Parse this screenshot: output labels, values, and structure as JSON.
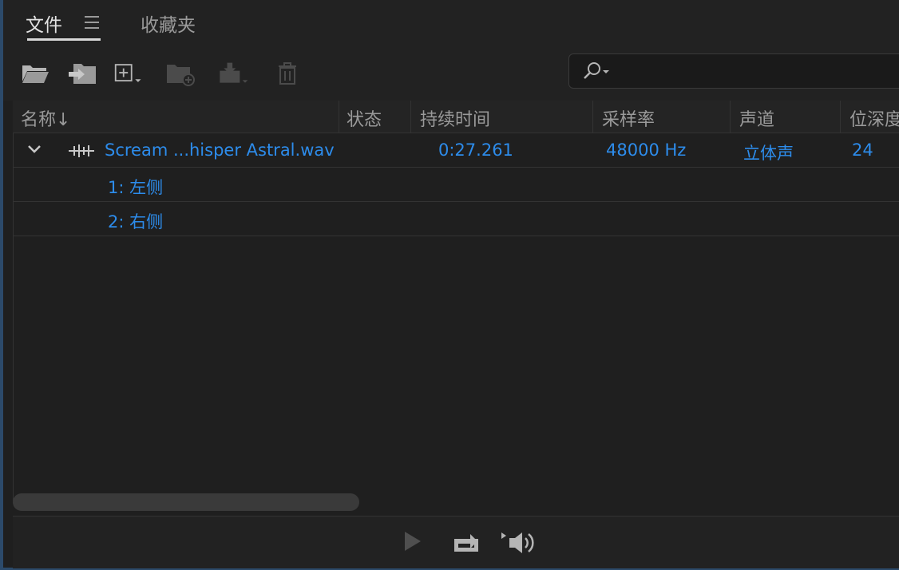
{
  "tabs": {
    "files_label": "文件",
    "favorites_label": "收藏夹"
  },
  "toolbar": {
    "icons": [
      "open-folder-icon",
      "import-folder-icon",
      "new-item-dropdown-icon",
      "new-bin-icon",
      "export-dropdown-icon",
      "trash-icon"
    ],
    "search_placeholder": ""
  },
  "table": {
    "columns": [
      "名称",
      "状态",
      "持续时间",
      "采样率",
      "声道",
      "位深度"
    ],
    "sort_indicator": "↓",
    "rows": [
      {
        "name": "Scream ...hisper Astral.wav",
        "status": "",
        "duration": "0:27.261",
        "sample_rate": "48000 Hz",
        "channels": "立体声",
        "bit_depth": "24"
      }
    ],
    "children": [
      {
        "label": "1: 左侧"
      },
      {
        "label": "2: 右侧"
      }
    ]
  },
  "colors": {
    "accent_blue": "#2d8ceb",
    "background": "#1f1f1f"
  }
}
